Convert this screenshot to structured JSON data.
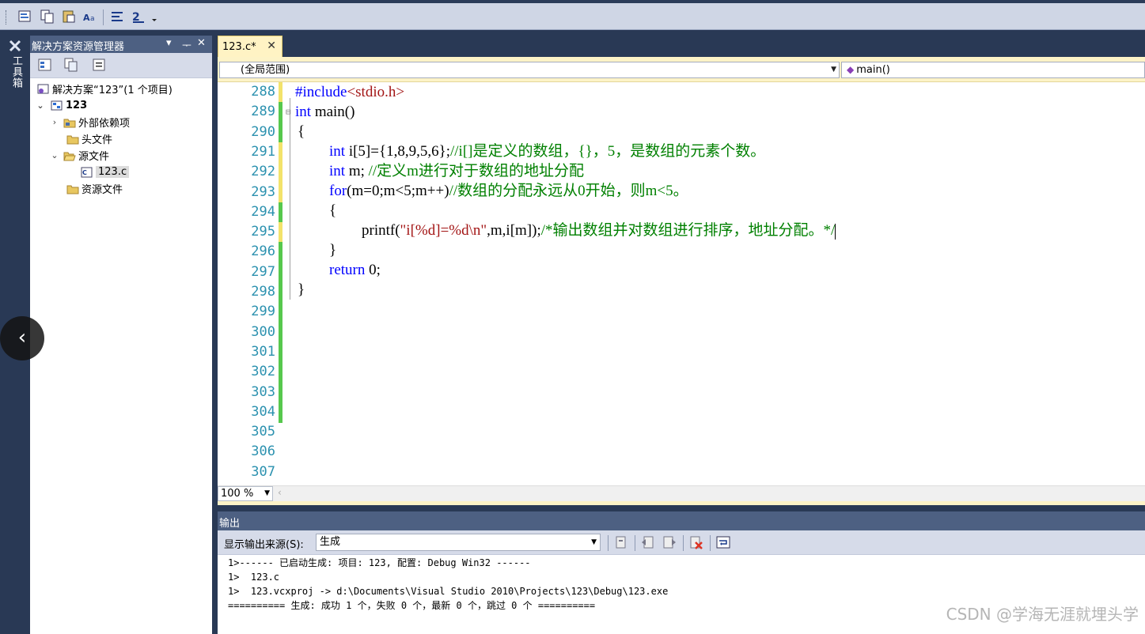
{
  "toolbar": {
    "icons": [
      "format-icon",
      "copy-icon",
      "paste-icon",
      "font-icon",
      "align-icon",
      "comment-icon",
      "more-icon"
    ]
  },
  "toolbox": {
    "label": "工具箱"
  },
  "solution_explorer": {
    "title": "解决方案资源管理器",
    "pin_glyph": "▾ ⊥ ✕",
    "tree": [
      {
        "label": "解决方案“123”(1 个项目)"
      },
      {
        "label": "123"
      },
      {
        "label": "外部依赖项"
      },
      {
        "label": "头文件"
      },
      {
        "label": "源文件"
      },
      {
        "label": "123.c"
      },
      {
        "label": "资源文件"
      }
    ]
  },
  "editor": {
    "tab_title": "123.c*",
    "tab_close": "✕",
    "scope": "(全局范围)",
    "member": "main()",
    "zoom": "100 %",
    "line_numbers": [
      "288",
      "289",
      "290",
      "291",
      "292",
      "293",
      "294",
      "295",
      "296",
      "297",
      "298",
      "299",
      "300",
      "301",
      "302",
      "303",
      "304",
      "305",
      "306",
      "307"
    ]
  },
  "code": {
    "l288_pp": "#include",
    "l288_hdr": "<stdio.h>",
    "l289_kw": "int",
    "l289_rest": " main()",
    "l290": "{",
    "l291_kw": "int",
    "l291_code": " i[5]={1,8,9,5,6};",
    "l291_cm": "//i[]是定义的数组，{}，5，是数组的元素个数。",
    "l292_kw": "int",
    "l292_code": " m; ",
    "l292_cm": "//定义m进行对于数组的地址分配",
    "l293_kw": "for",
    "l293_code": "(m=0;m<5;m++)",
    "l293_cm": "//数组的分配永远从0开始，则m<5。",
    "l294": "{",
    "l295_code": "printf(",
    "l295_str": "\"i[%d]=%d\\n\"",
    "l295_code2": ",m,i[m]);",
    "l295_cm": "/*输出数组并对数组进行排序，地址分配。*/",
    "l296": "}",
    "l297_kw": "return",
    "l297_code": " 0;",
    "l298": "}"
  },
  "output": {
    "title": "输出",
    "source_label": "显示输出来源(S):",
    "source_value": "生成",
    "lines": [
      "1>------ 已启动生成: 项目: 123, 配置: Debug Win32 ------",
      "1>  123.c",
      "1>  123.vcxproj -> d:\\Documents\\Visual Studio 2010\\Projects\\123\\Debug\\123.exe",
      "========== 生成: 成功 1 个，失败 0 个，最新 0 个，跳过 0 个 =========="
    ]
  },
  "overlay": {
    "back_glyph": "‹"
  },
  "watermark": "CSDN @学海无涯就埋头学",
  "colors": {
    "accent_dark": "#293955",
    "header": "#4d6082",
    "change_saved": "#57c84d",
    "change_unsaved": "#f3e36b"
  }
}
